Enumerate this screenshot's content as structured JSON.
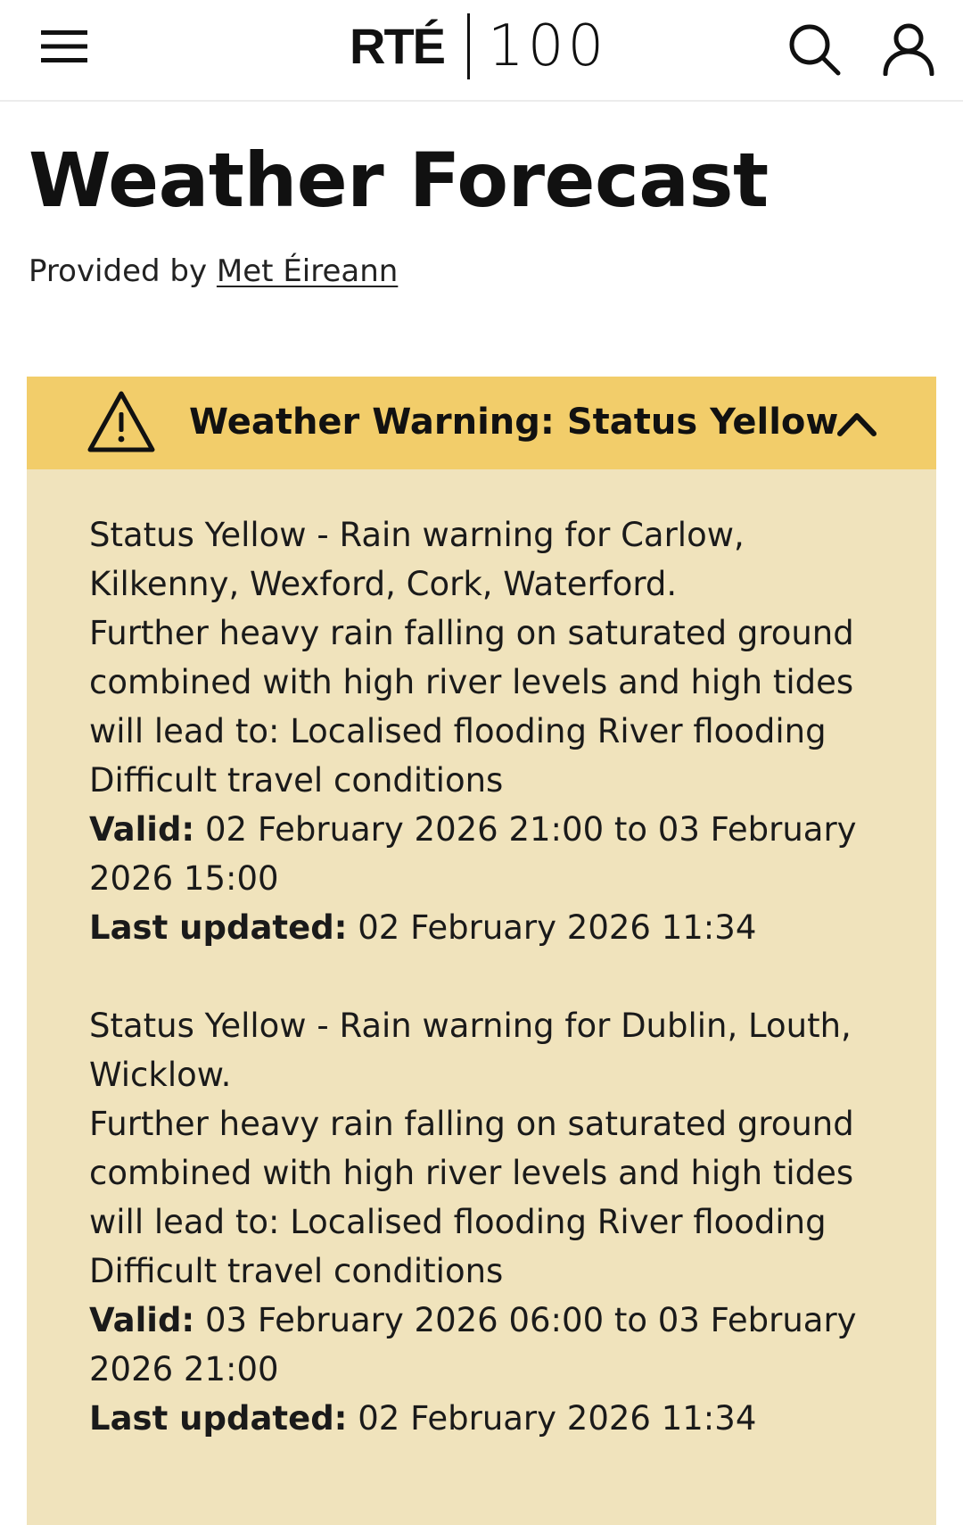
{
  "header": {
    "brand_rte": "RTÉ",
    "brand_100": "100",
    "menu_icon": "hamburger-menu-icon",
    "search_icon": "search-icon",
    "account_icon": "user-account-icon"
  },
  "page": {
    "title": "Weather Forecast",
    "provided_prefix": "Provided by",
    "provider_link": "Met Éireann"
  },
  "warning": {
    "header_title": "Weather Warning: Status Yellow",
    "header_bg_color": "#f2cd6a",
    "body_bg_color": "#f0e3bc",
    "icon": "warning-triangle-icon",
    "toggle_icon": "chevron-up-icon",
    "valid_label": "Valid:",
    "updated_label": "Last updated:",
    "alerts": [
      {
        "headline": "Status Yellow - Rain warning for Carlow, Kilkenny, Wexford, Cork, Waterford.",
        "description": "Further heavy rain falling on saturated ground combined with high river levels and high tides will lead to: Localised flooding River flooding Difficult travel conditions",
        "valid": "02 February 2026 21:00 to 03 February 2026 15:00",
        "last_updated": "02 February 2026 11:34"
      },
      {
        "headline": "Status Yellow - Rain warning for Dublin, Louth, Wicklow.",
        "description": "Further heavy rain falling on saturated ground combined with high river levels and high tides will lead to: Localised flooding River flooding Difficult travel conditions",
        "valid": "03 February 2026 06:00 to 03 February 2026 21:00",
        "last_updated": "02 February 2026 11:34"
      }
    ]
  }
}
